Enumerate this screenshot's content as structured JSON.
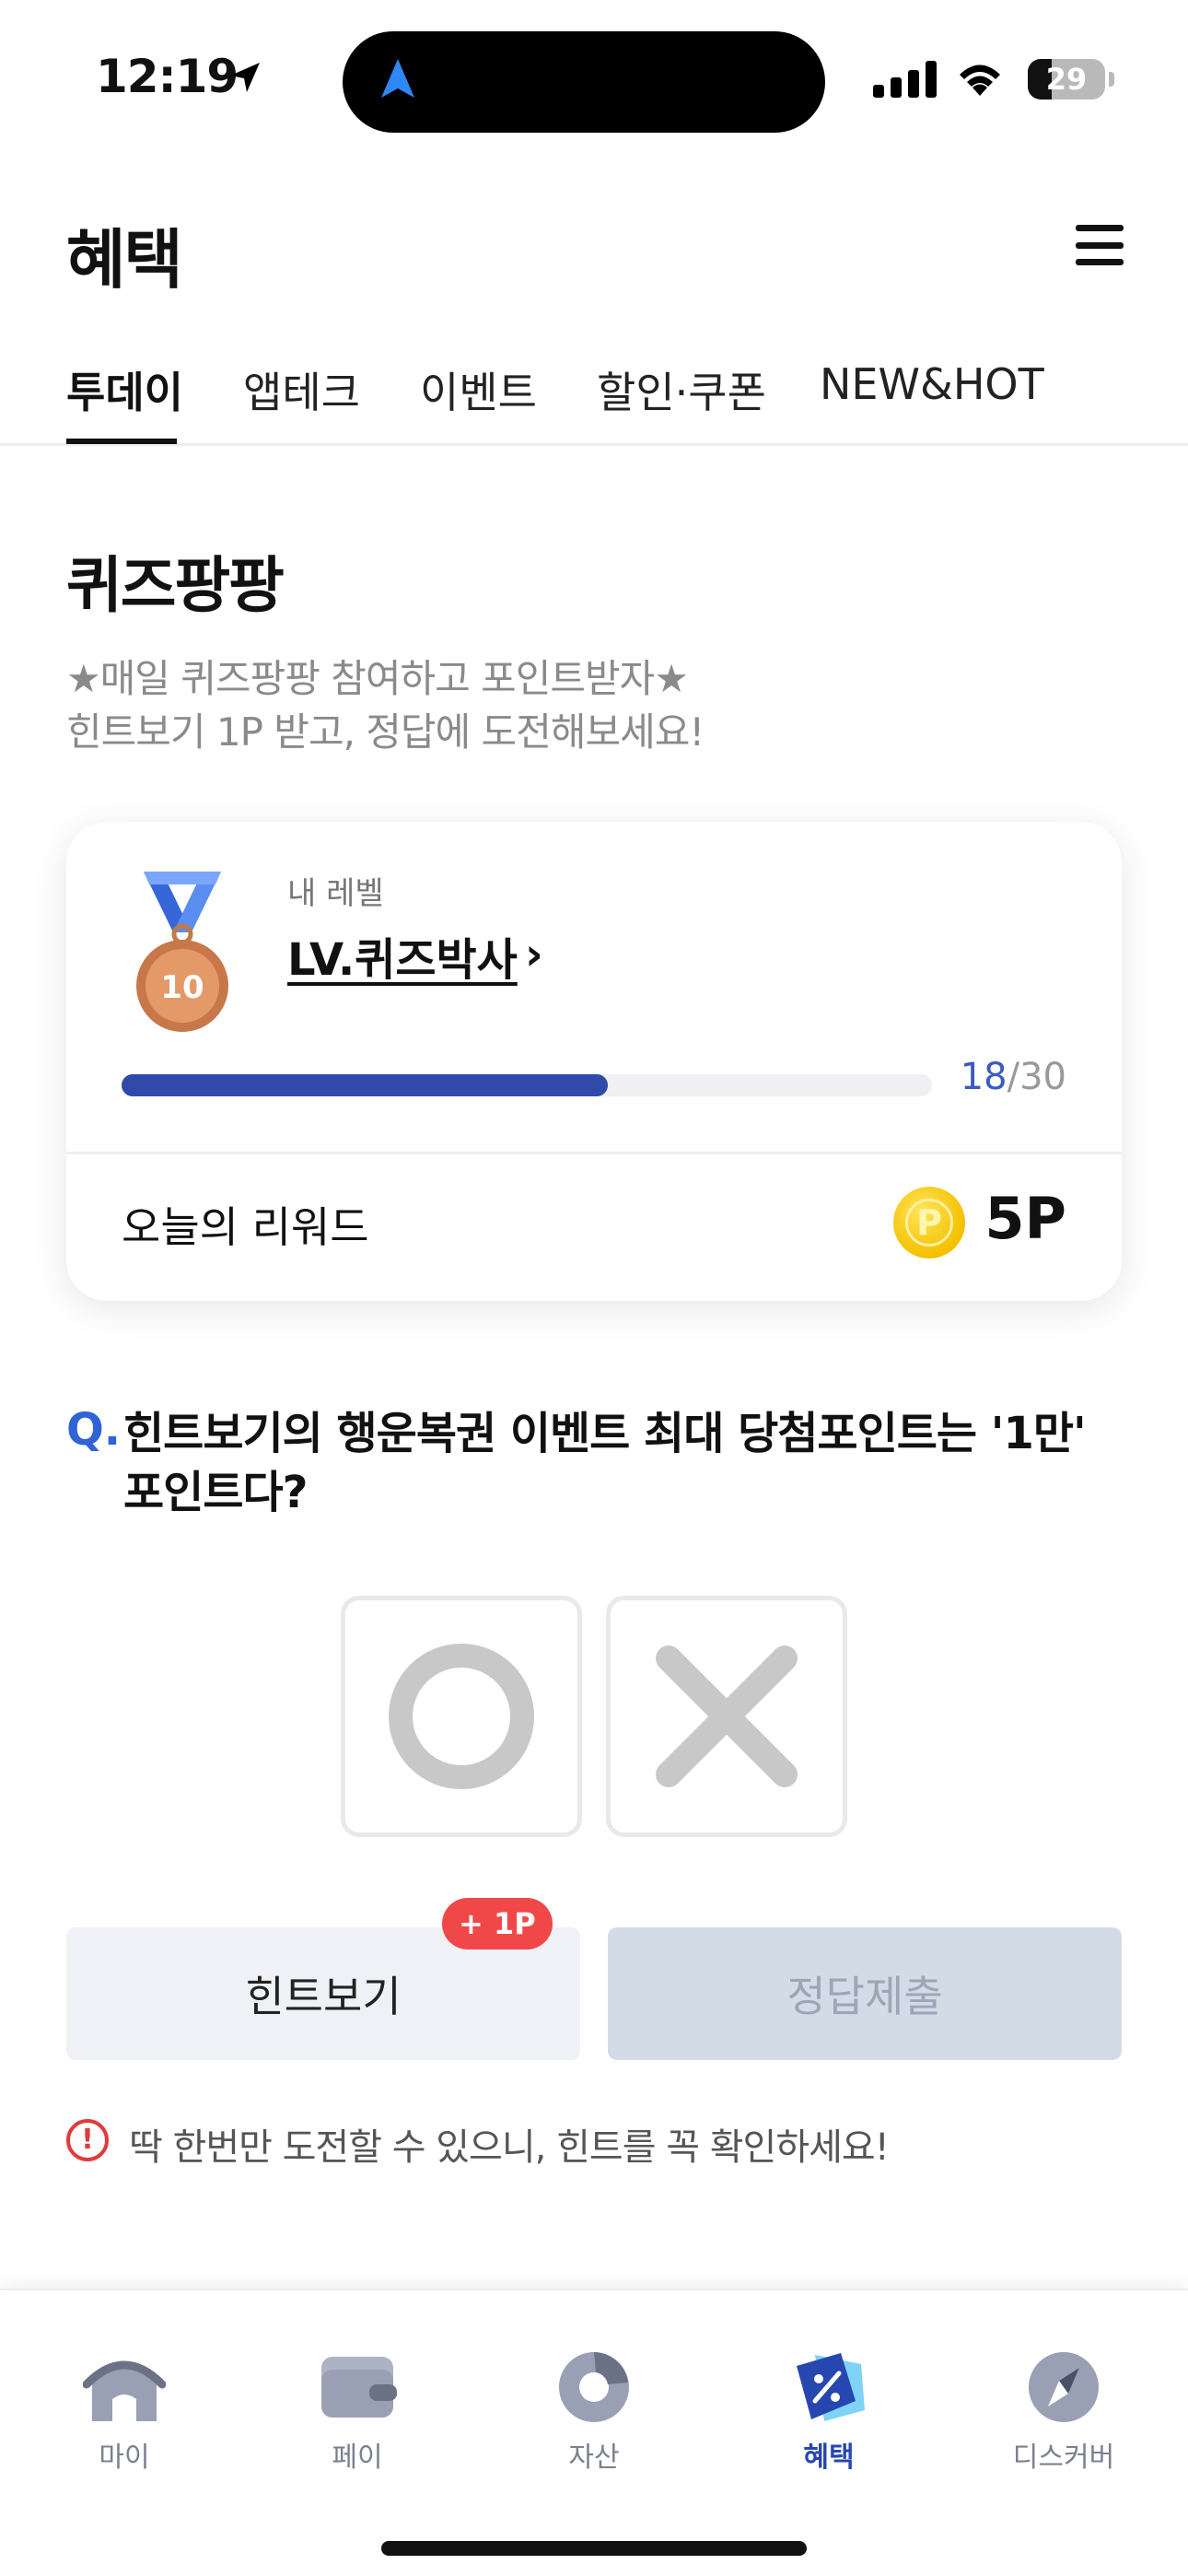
{
  "status_bar": {
    "time": "12:19",
    "battery": "29"
  },
  "header": {
    "title": "혜택"
  },
  "tabs": [
    {
      "label": "투데이",
      "active": true
    },
    {
      "label": "앱테크",
      "active": false
    },
    {
      "label": "이벤트",
      "active": false
    },
    {
      "label": "할인·쿠폰",
      "active": false
    },
    {
      "label": "NEW&HOT",
      "active": false
    }
  ],
  "quiz": {
    "title": "퀴즈팡팡",
    "desc_line1": "★매일 퀴즈팡팡 참여하고 포인트받자★",
    "desc_line2": "힌트보기 1P 받고, 정답에 도전해보세요!"
  },
  "level_card": {
    "caption": "내 레벨",
    "name": "LV.퀴즈박사",
    "medal_number": "10",
    "progress_current": "18",
    "progress_sep_total": "/30",
    "progress_fraction": 0.6,
    "reward_label": "오늘의 리워드",
    "coin_letter": "P",
    "reward_value": "5P"
  },
  "question": {
    "q_mark": "Q.",
    "text": "힌트보기의 행운복권 이벤트 최대 당첨포인트는 '1만' 포인트다?"
  },
  "answers": {
    "o_icon": "circle-o-icon",
    "x_icon": "x-mark-icon"
  },
  "buttons": {
    "hint_label": "힌트보기",
    "hint_badge": "+ 1P",
    "submit_label": "정답제출"
  },
  "notice": {
    "icon": "!",
    "text": "딱 한번만 도전할 수 있으니, 힌트를 꼭 확인하세요!"
  },
  "bottom_nav": [
    {
      "label": "마이",
      "icon": "home-icon",
      "active": false
    },
    {
      "label": "페이",
      "icon": "wallet-icon",
      "active": false
    },
    {
      "label": "자산",
      "icon": "pie-chart-icon",
      "active": false
    },
    {
      "label": "혜택",
      "icon": "discount-tag-icon",
      "active": true
    },
    {
      "label": "디스커버",
      "icon": "compass-icon",
      "active": false
    }
  ],
  "colors": {
    "accent": "#2f4aa8",
    "question_mark": "#2f63d6",
    "badge_red": "#f04848",
    "coin_gold": "#f4c000"
  }
}
